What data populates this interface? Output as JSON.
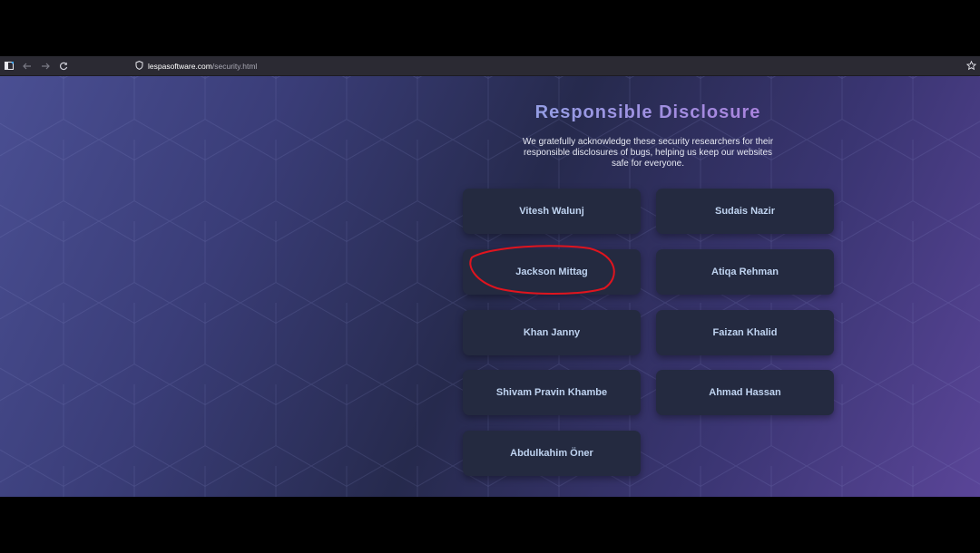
{
  "browser": {
    "url_host": "lespasoftware.com",
    "url_path": "/security.html"
  },
  "page": {
    "title": "Responsible Disclosure",
    "subtitle": "We gratefully acknowledge these security researchers for their responsible disclosures of bugs, helping us keep our websites safe for everyone.",
    "researchers": [
      "Vitesh Walunj",
      "Sudais Nazir",
      "Jackson Mittag",
      "Atiqa Rehman",
      "Khan Janny",
      "Faizan Khalid",
      "Shivam Pravin Khambe",
      "Ahmad Hassan",
      "Abdulkahim Öner"
    ]
  },
  "colors": {
    "accent_start": "#8ea6e6",
    "accent_end": "#b07bdc",
    "card_bg": "#242a40",
    "annotation": "#e0141e"
  }
}
